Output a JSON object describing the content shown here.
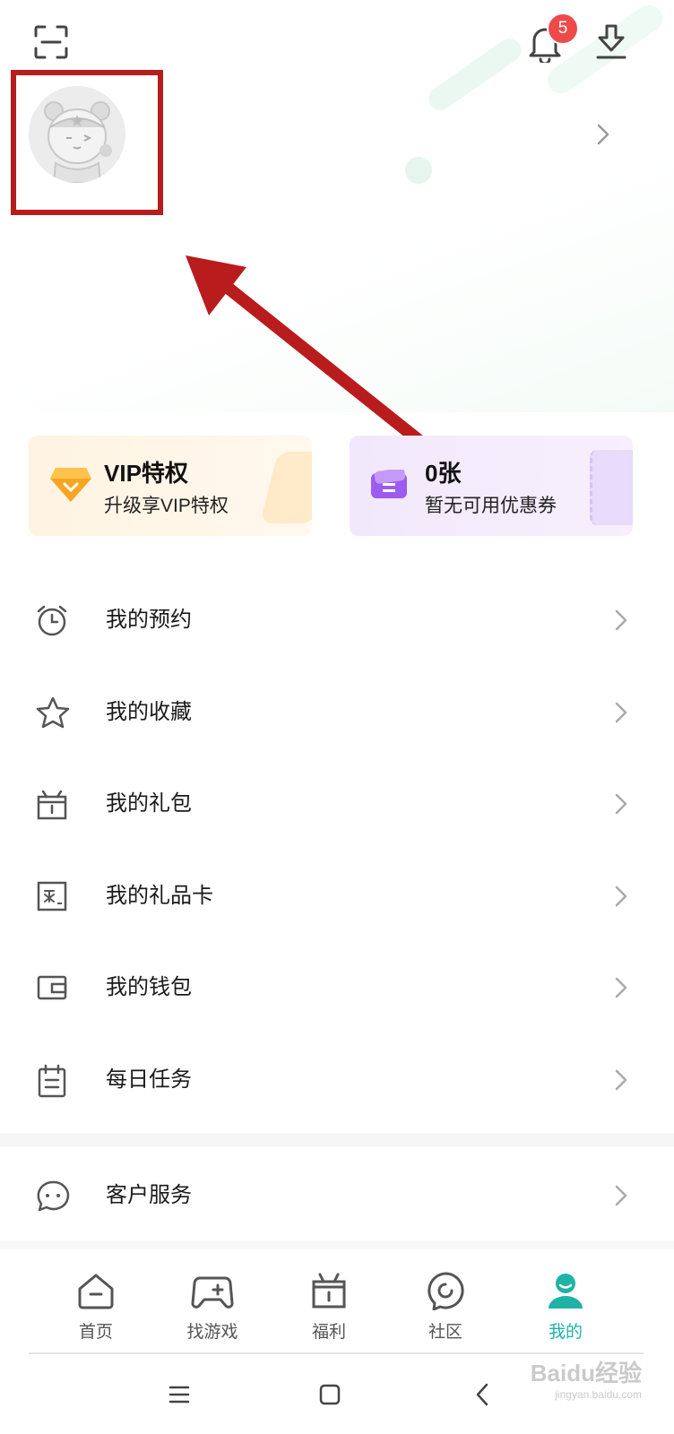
{
  "header": {
    "scan_icon": "scan-icon",
    "notifications": {
      "icon": "bell-icon",
      "badge": "5"
    },
    "download_icon": "download-icon"
  },
  "annotation": {
    "highlight_color": "#b81c1c",
    "arrow_color": "#b81c1c"
  },
  "cards": {
    "vip": {
      "title": "VIP特权",
      "subtitle": "升级享VIP特权",
      "icon": "diamond-icon"
    },
    "coupon": {
      "title": "0张",
      "subtitle": "暂无可用优惠券",
      "icon": "ticket-icon"
    }
  },
  "menu": [
    {
      "label": "我的预约",
      "icon": "alarm-clock-icon"
    },
    {
      "label": "我的收藏",
      "icon": "star-icon"
    },
    {
      "label": "我的礼包",
      "icon": "gift-box-icon"
    },
    {
      "label": "我的礼品卡",
      "icon": "gift-card-icon"
    },
    {
      "label": "我的钱包",
      "icon": "wallet-icon"
    },
    {
      "label": "每日任务",
      "icon": "task-list-icon"
    }
  ],
  "service": {
    "label": "客户服务",
    "icon": "chat-bubble-icon"
  },
  "tabbar": [
    {
      "label": "首页",
      "icon": "home-icon"
    },
    {
      "label": "找游戏",
      "icon": "gamepad-icon"
    },
    {
      "label": "福利",
      "icon": "gift-icon"
    },
    {
      "label": "社区",
      "icon": "community-icon"
    },
    {
      "label": "我的",
      "icon": "profile-icon",
      "active": true
    }
  ],
  "watermark": {
    "brand": "Baidu经验",
    "url": "jingyan.baidu.com"
  },
  "colors": {
    "accent": "#1fb3a6",
    "badge": "#ef4a4a",
    "vip_card": "#fff3df",
    "coupon_card": "#f3eafc"
  }
}
